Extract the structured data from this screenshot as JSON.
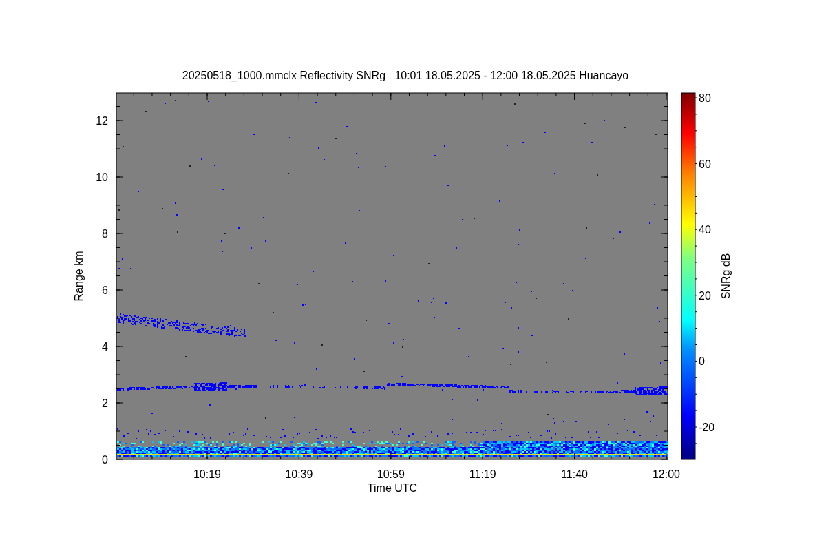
{
  "title": "20250518_1000.mmclx Reflectivity SNRg   10:01 18.05.2025 - 12:00 18.05.2025 Huancayo",
  "y_axis": {
    "label": "Range km",
    "ticks": [
      "12",
      "10",
      "8",
      "6",
      "4",
      "2",
      "0"
    ]
  },
  "x_axis": {
    "label": "Time UTC",
    "ticks": [
      "10:19",
      "10:39",
      "10:59",
      "11:19",
      "11:40",
      "12:00"
    ]
  },
  "colorbar": {
    "label": "SNRg dB",
    "ticks": [
      "80",
      "60",
      "40",
      "20",
      "0",
      "-20"
    ]
  }
}
